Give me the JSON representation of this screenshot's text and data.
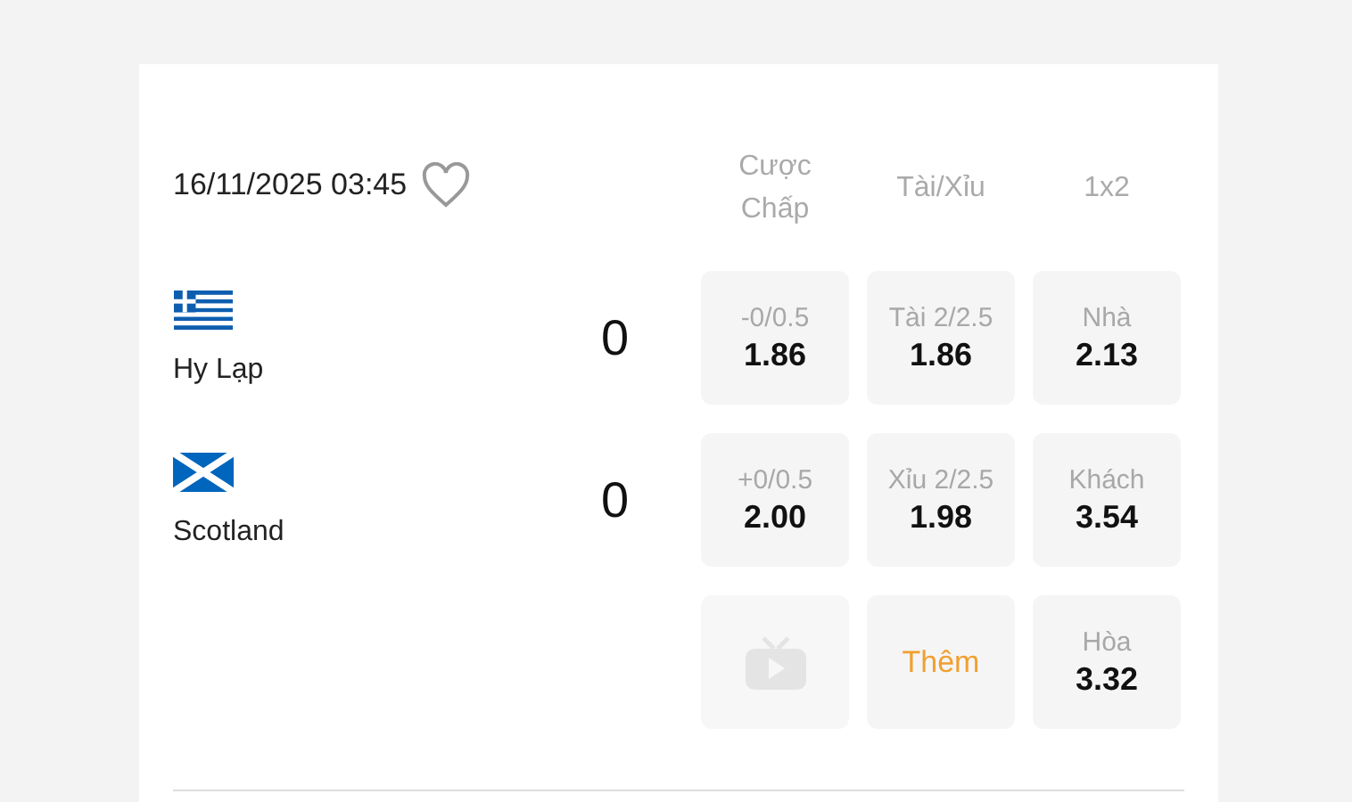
{
  "match": {
    "kickoff": "16/11/2025 03:45",
    "favorite": false,
    "market_headers": [
      "Cược Chấp",
      "Tài/Xỉu",
      "1x2"
    ],
    "teams": [
      {
        "name": "Hy Lạp",
        "score": "0",
        "flag": {
          "kind": "greece"
        }
      },
      {
        "name": "Scotland",
        "score": "0",
        "flag": {
          "kind": "scotland"
        }
      }
    ],
    "odds_rows": [
      [
        {
          "kind": "odds",
          "label": "-0/0.5",
          "value": "1.86"
        },
        {
          "kind": "odds",
          "label": "Tài 2/2.5",
          "value": "1.86"
        },
        {
          "kind": "odds",
          "label": "Nhà",
          "value": "2.13"
        }
      ],
      [
        {
          "kind": "odds",
          "label": "+0/0.5",
          "value": "2.00"
        },
        {
          "kind": "odds",
          "label": "Xỉu 2/2.5",
          "value": "1.98"
        },
        {
          "kind": "odds",
          "label": "Khách",
          "value": "3.54"
        }
      ],
      [
        {
          "kind": "stream",
          "disabled": true
        },
        {
          "kind": "more",
          "label": "Thêm"
        },
        {
          "kind": "odds",
          "label": "Hòa",
          "value": "3.32"
        }
      ]
    ]
  }
}
